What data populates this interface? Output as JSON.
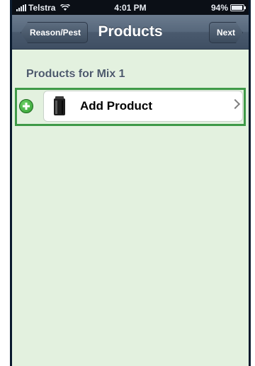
{
  "status_bar": {
    "carrier": "Telstra",
    "time": "4:01 PM",
    "battery": "94%",
    "battery_level": 0.94,
    "signal_icon": "signal-icon",
    "wifi_icon": "wifi-icon",
    "battery_icon": "battery-icon"
  },
  "nav": {
    "back_label": "Reason/Pest",
    "title": "Products",
    "next_label": "Next"
  },
  "content": {
    "section_header": "Products for Mix 1",
    "rows": [
      {
        "label": "Add Product",
        "leading_icon": "add-circle-icon",
        "item_icon": "product-container-icon",
        "accessory_icon": "chevron-right-icon"
      }
    ]
  },
  "colors": {
    "background": "#e3f1df",
    "highlight_outline": "#3f9a48",
    "navbar": "#56677b",
    "add_icon": "#2f9c30"
  }
}
